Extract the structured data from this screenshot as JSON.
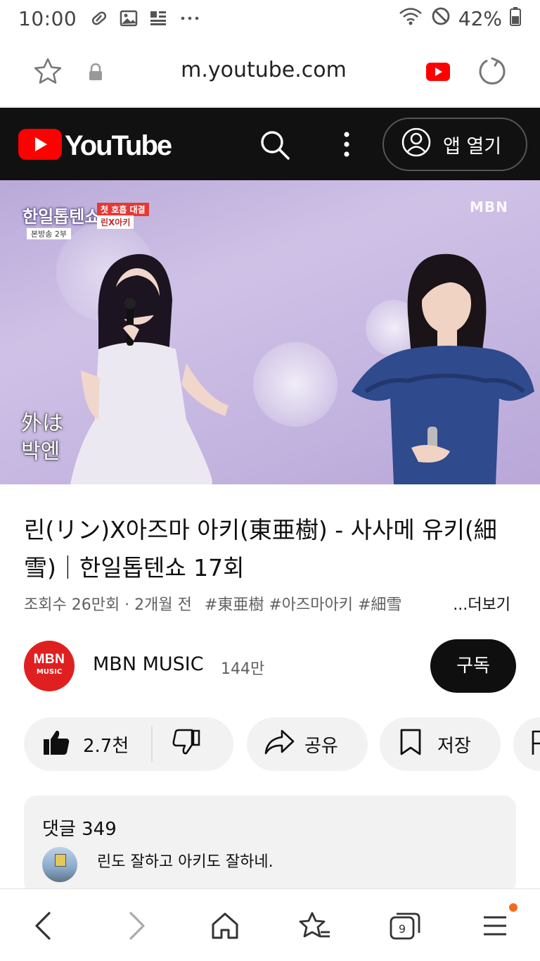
{
  "status_bar": {
    "time": "10:00",
    "battery": "42%"
  },
  "browser": {
    "url": "m.youtube.com"
  },
  "header": {
    "wordmark": "YouTube",
    "open_app_label": "앱 열기"
  },
  "video": {
    "show_title": "한일톱텐쇼",
    "show_badge_1": "첫 호흡 대결",
    "show_badge_2": "린X아키",
    "show_badge_3": "본방송 2부",
    "broadcaster": "MBN",
    "caption_line_1": "外は",
    "caption_line_2": "박엔"
  },
  "title": "린(リン)X아즈마 아키(東亜樹) - 사사메 유키(細雪)｜한일톱텐쇼 17회",
  "meta": {
    "views_date": "조회수 26만회 · 2개월 전",
    "tags": "#東亜樹 #아즈마아키 #細雪",
    "more": "...더보기"
  },
  "channel": {
    "avatar_line_1": "MBN",
    "avatar_line_2": "MUSIC",
    "name": "MBN MUSIC",
    "subscribers": "144만",
    "subscribe_label": "구독"
  },
  "actions": {
    "like_count": "2.7천",
    "share_label": "공유",
    "save_label": "저장"
  },
  "comments": {
    "header": "댓글 349",
    "first_comment": "린도 잘하고 아키도 잘하네."
  },
  "bottom_nav": {
    "tab_count": "9"
  },
  "colors": {
    "youtube_red": "#ff0000",
    "header_bg": "#111111",
    "pill_bg": "#f2f2f2",
    "notification_dot": "#f36b1c"
  }
}
